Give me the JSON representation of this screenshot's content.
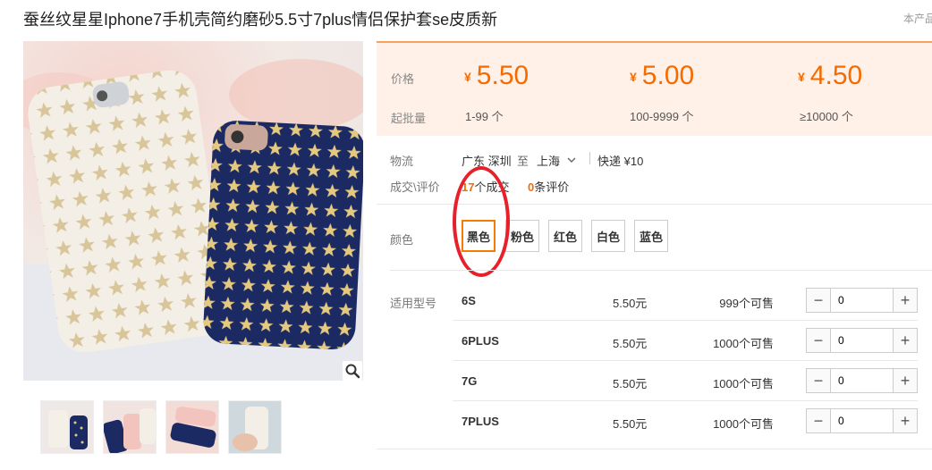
{
  "title": "蚕丝纹星星Iphone7手机壳简约磨砂5.5寸7plus情侣保护套se皮质新",
  "top_right_text": "本产品",
  "price": {
    "price_label": "价格",
    "min_qty_label": "起批量",
    "currency": "¥",
    "tiers": [
      {
        "price": "5.50",
        "range": "1-99 个"
      },
      {
        "price": "5.00",
        "range": "100-9999 个"
      },
      {
        "price": "4.50",
        "range": "≥10000 个"
      }
    ]
  },
  "logistics": {
    "label": "物流",
    "from": "广东 深圳",
    "to_word": "至",
    "to": "上海",
    "express": "快递 ¥10"
  },
  "trade": {
    "label": "成交\\评价",
    "deals_count": "17",
    "deals_suffix": "个成交",
    "reviews_count": "0",
    "reviews_suffix": "条评价"
  },
  "colors": {
    "label": "颜色",
    "options": [
      "黑色",
      "粉色",
      "红色",
      "白色",
      "蓝色"
    ],
    "selected": "黑色"
  },
  "models": {
    "label": "适用型号",
    "rows": [
      {
        "name": "6S",
        "price": "5.50元",
        "stock": "999个可售",
        "qty": "0"
      },
      {
        "name": "6PLUS",
        "price": "5.50元",
        "stock": "1000个可售",
        "qty": "0"
      },
      {
        "name": "7G",
        "price": "5.50元",
        "stock": "1000个可售",
        "qty": "0"
      },
      {
        "name": "7PLUS",
        "price": "5.50元",
        "stock": "1000个可售",
        "qty": "0"
      }
    ]
  },
  "icons": {
    "zoom": "magnifier-icon",
    "dropdown": "chevron-down-icon",
    "minus": "minus-icon",
    "plus": "plus-icon"
  },
  "accent_colors": {
    "price": "#f56b00",
    "price_bg": "#fff1e8",
    "annotation": "#e8202a"
  }
}
